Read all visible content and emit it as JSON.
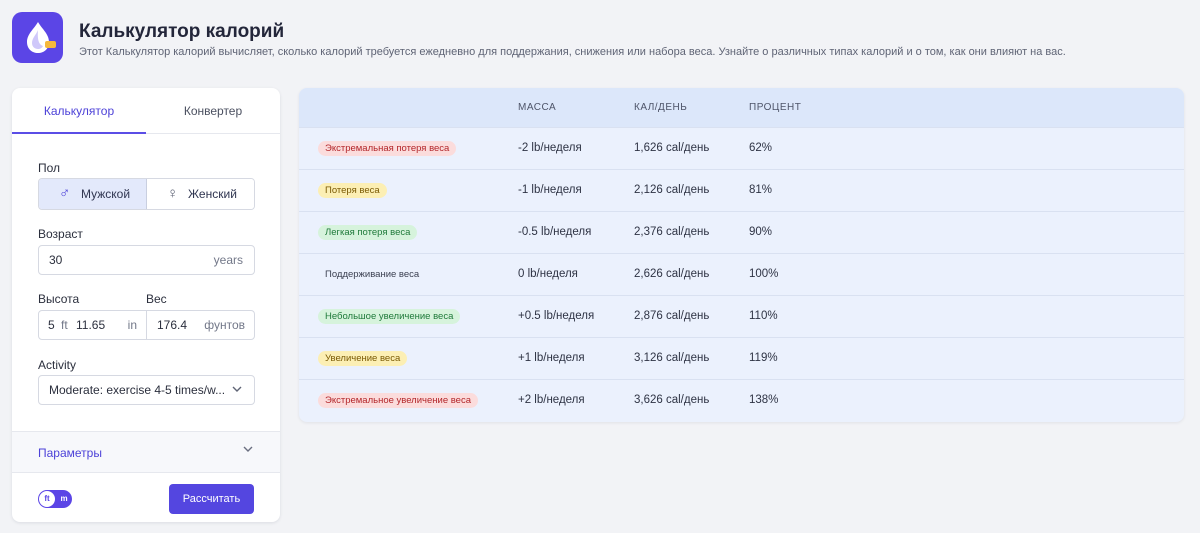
{
  "header": {
    "title": "Калькулятор калорий",
    "subtitle": "Этот Калькулятор калорий вычисляет, сколько калорий требуется ежедневно для поддержания, снижения или набора веса. Узнайте о различных типах калорий и о том, как они влияют на вас.",
    "app_icon": "flame-drop-icon"
  },
  "tabs": [
    {
      "label": "Калькулятор",
      "active": true
    },
    {
      "label": "Конвертер",
      "active": false
    }
  ],
  "form": {
    "gender_label": "Пол",
    "gender_options": [
      {
        "label": "Мужской",
        "icon": "male-icon",
        "selected": true
      },
      {
        "label": "Женский",
        "icon": "female-icon",
        "selected": false
      }
    ],
    "age_label": "Возраст",
    "age_value": "30",
    "age_unit": "years",
    "height_label": "Высота",
    "height_ft": "5",
    "height_ft_unit": "ft",
    "height_in": "11.65",
    "height_in_unit": "in",
    "weight_label": "Вес",
    "weight_value": "176.4",
    "weight_unit": "фунтов",
    "activity_label": "Activity",
    "activity_value": "Moderate: exercise 4-5 times/w...",
    "params_label": "Параметры",
    "unit_toggle": {
      "left": "ft",
      "right": "m"
    },
    "calc_button": "Рассчитать"
  },
  "table": {
    "headers": [
      "МАССА",
      "КАЛ/ДЕНЬ",
      "ПРОЦЕНТ"
    ],
    "rows": [
      {
        "label": "Экстремальная потеря веса",
        "mass": "-2 lb/неделя",
        "cal": "1,626 cal/день",
        "pct": "62%",
        "tone": "red"
      },
      {
        "label": "Потеря веса",
        "mass": "-1 lb/неделя",
        "cal": "2,126 cal/день",
        "pct": "81%",
        "tone": "yellow"
      },
      {
        "label": "Легкая потеря веса",
        "mass": "-0.5 lb/неделя",
        "cal": "2,376 cal/день",
        "pct": "90%",
        "tone": "green"
      },
      {
        "label": "Поддерживание веса",
        "mass": "0 lb/неделя",
        "cal": "2,626 cal/день",
        "pct": "100%",
        "tone": "none"
      },
      {
        "label": "Небольшое увеличение веса",
        "mass": "+0.5 lb/неделя",
        "cal": "2,876 cal/день",
        "pct": "110%",
        "tone": "green"
      },
      {
        "label": "Увеличение веса",
        "mass": "+1 lb/неделя",
        "cal": "3,126 cal/день",
        "pct": "119%",
        "tone": "yellow"
      },
      {
        "label": "Экстремальное увеличение веса",
        "mass": "+2 lb/неделя",
        "cal": "3,626 cal/день",
        "pct": "138%",
        "tone": "red"
      }
    ]
  },
  "colors": {
    "accent": "#5b45e6",
    "badge_red_bg": "#fbdcdc",
    "badge_red_fg": "#b3262a",
    "badge_yellow_bg": "#fcefb4",
    "badge_yellow_fg": "#7a5a04",
    "badge_green_bg": "#d6f3dc",
    "badge_green_fg": "#1f7a3a"
  }
}
